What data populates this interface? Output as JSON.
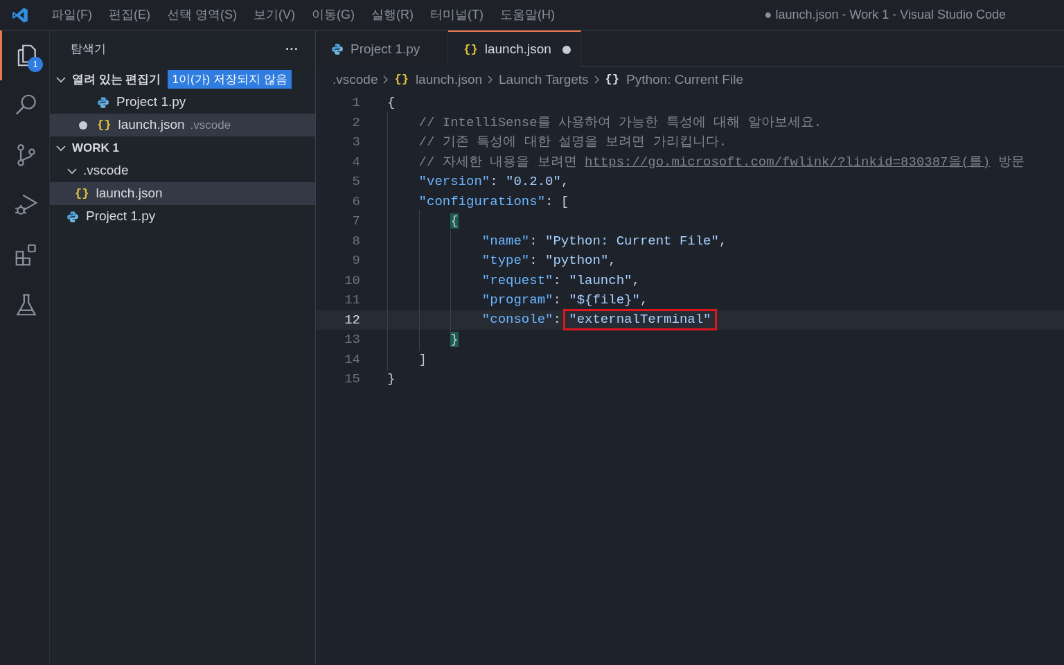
{
  "menu": [
    "파일(F)",
    "편집(E)",
    "선택 영역(S)",
    "보기(V)",
    "이동(G)",
    "실행(R)",
    "터미널(T)",
    "도움말(H)"
  ],
  "window": {
    "title": "● launch.json - Work 1 - Visual Studio Code"
  },
  "activity_bar": [
    {
      "kind": "explorer",
      "selected": true,
      "badge": "1"
    },
    {
      "kind": "search",
      "selected": false
    },
    {
      "kind": "source-control",
      "selected": false
    },
    {
      "kind": "debug",
      "selected": false
    },
    {
      "kind": "extensions",
      "selected": false
    },
    {
      "kind": "testing",
      "selected": false
    }
  ],
  "sidebar": {
    "title": "탐색기",
    "more": "···",
    "open_editors": {
      "label": "열려 있는 편집기",
      "expanded": true,
      "badge": "1이(가) 저장되지 않음",
      "items": [
        {
          "name": "Project 1.py",
          "kind": "python",
          "dirty": false,
          "selected": false
        },
        {
          "name": "launch.json",
          "kind": "json",
          "glyph": "{}",
          "detail": ".vscode",
          "dirty": true,
          "selected": true
        }
      ]
    },
    "workspace": {
      "label": "WORK 1",
      "expanded": true,
      "children": [
        {
          "name": ".vscode",
          "kind": "folder",
          "expanded": true,
          "selected": false,
          "children": [
            {
              "name": "launch.json",
              "kind": "json",
              "glyph": "{}",
              "selected": true
            }
          ]
        },
        {
          "name": "Project 1.py",
          "kind": "python",
          "selected": false
        }
      ]
    }
  },
  "tabs": [
    {
      "label": "Project 1.py",
      "kind": "python",
      "selected": false,
      "dirty": false
    },
    {
      "label": "launch.json",
      "kind": "json",
      "glyph": "{}",
      "selected": true,
      "dirty": true
    }
  ],
  "breadcrumbs": [
    {
      "label": ".vscode"
    },
    {
      "label": "launch.json",
      "glyph": "{}",
      "kind": "json"
    },
    {
      "label": "Launch Targets"
    },
    {
      "label": "Python: Current File",
      "glyph": "{}",
      "kind": "object"
    }
  ],
  "editor": {
    "lines": [
      {
        "number": "1",
        "tokens": [
          {
            "kind": "punct",
            "text": "{"
          }
        ]
      },
      {
        "number": "2",
        "tokens": [
          {
            "kind": "comment",
            "text": "    // IntelliSense를 사용하여 가능한 특성에 대해 알아보세요."
          }
        ]
      },
      {
        "number": "3",
        "tokens": [
          {
            "kind": "comment",
            "text": "    // 기존 특성에 대한 설명을 보려면 가리킵니다."
          }
        ]
      },
      {
        "number": "4",
        "tokens": [
          {
            "kind": "comment",
            "text": "    // 자세한 내용을 보려면 "
          },
          {
            "kind": "link",
            "text": "https://go.microsoft.com/fwlink/?linkid=830387을(를)"
          },
          {
            "kind": "comment",
            "text": " 방문"
          }
        ]
      },
      {
        "number": "5",
        "tokens": [
          {
            "kind": "key",
            "text": "    \"version\""
          },
          {
            "kind": "punct",
            "text": ": "
          },
          {
            "kind": "string",
            "text": "\"0.2.0\""
          },
          {
            "kind": "punct",
            "text": ","
          }
        ]
      },
      {
        "number": "6",
        "tokens": [
          {
            "kind": "key",
            "text": "    \"configurations\""
          },
          {
            "kind": "punct",
            "text": ": ["
          }
        ]
      },
      {
        "number": "7",
        "tokens": [
          {
            "kind": "brace",
            "text": "        {",
            "matched": true
          }
        ]
      },
      {
        "number": "8",
        "tokens": [
          {
            "kind": "key",
            "text": "            \"name\""
          },
          {
            "kind": "punct",
            "text": ": "
          },
          {
            "kind": "string",
            "text": "\"Python: Current File\""
          },
          {
            "kind": "punct",
            "text": ","
          }
        ]
      },
      {
        "number": "9",
        "tokens": [
          {
            "kind": "key",
            "text": "            \"type\""
          },
          {
            "kind": "punct",
            "text": ": "
          },
          {
            "kind": "string",
            "text": "\"python\""
          },
          {
            "kind": "punct",
            "text": ","
          }
        ]
      },
      {
        "number": "10",
        "tokens": [
          {
            "kind": "key",
            "text": "            \"request\""
          },
          {
            "kind": "punct",
            "text": ": "
          },
          {
            "kind": "string",
            "text": "\"launch\""
          },
          {
            "kind": "punct",
            "text": ","
          }
        ]
      },
      {
        "number": "11",
        "tokens": [
          {
            "kind": "key",
            "text": "            \"program\""
          },
          {
            "kind": "punct",
            "text": ": "
          },
          {
            "kind": "string",
            "text": "\"${file}\""
          },
          {
            "kind": "punct",
            "text": ","
          }
        ]
      },
      {
        "number": "12",
        "current": true,
        "tokens": [
          {
            "kind": "key",
            "text": "            \"console\""
          },
          {
            "kind": "punct",
            "text": ": "
          },
          {
            "kind": "string",
            "text": "\"externalTerminal\"",
            "highlighted": true
          }
        ]
      },
      {
        "number": "13",
        "tokens": [
          {
            "kind": "brace",
            "text": "        }",
            "matched": true
          }
        ]
      },
      {
        "number": "14",
        "tokens": [
          {
            "kind": "punct",
            "text": "    ]"
          }
        ]
      },
      {
        "number": "15",
        "tokens": [
          {
            "kind": "punct",
            "text": "}"
          }
        ]
      }
    ]
  }
}
